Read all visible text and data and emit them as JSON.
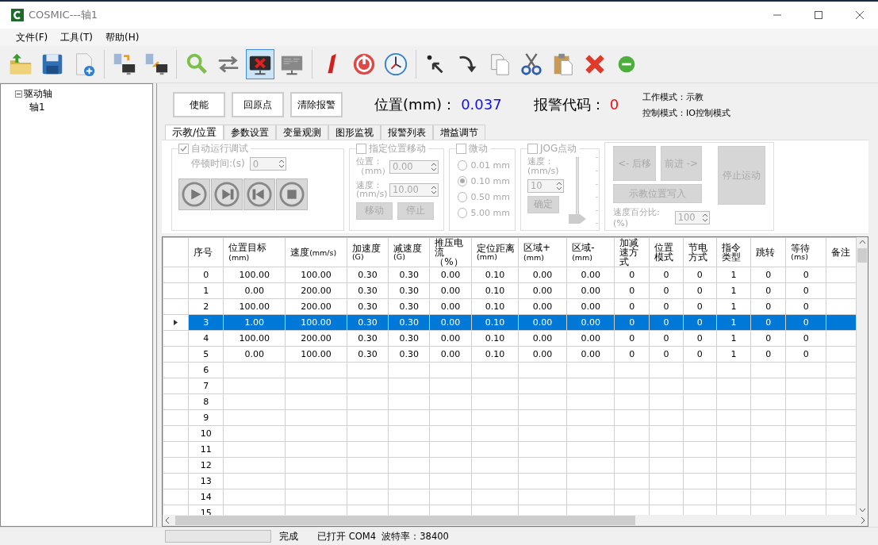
{
  "window": {
    "title": "COSMIC---轴1"
  },
  "menu": [
    "文件(F)",
    "工具(T)",
    "帮助(H)"
  ],
  "toolbar": [
    {
      "pressed": false
    },
    {
      "pressed": false
    },
    {
      "pressed": false
    },
    {
      "pressed": false
    },
    {
      "pressed": false
    },
    {
      "pressed": false
    },
    {
      "pressed": false
    },
    {
      "pressed": true
    },
    {
      "pressed": false
    },
    {
      "pressed": false
    },
    {
      "pressed": false
    },
    {
      "pressed": false
    },
    {
      "pressed": false
    },
    {
      "pressed": false
    },
    {
      "pressed": false
    },
    {
      "pressed": false
    },
    {
      "pressed": false
    },
    {
      "pressed": false
    },
    {
      "pressed": false
    }
  ],
  "tree": [
    {
      "label": "驱动轴",
      "expanded": true,
      "children": [
        {
          "label": "轴1"
        }
      ]
    }
  ],
  "actions": [
    "使能",
    "回原点",
    "清除报警"
  ],
  "position": {
    "label": "位置(mm)：",
    "value": "0.037"
  },
  "alarm": {
    "label": "报警代码：",
    "value": "0"
  },
  "modes": [
    "工作模式：示教",
    "控制模式：IO控制模式"
  ],
  "tabs": [
    {
      "label": "示教/位置",
      "selected": true
    },
    {
      "label": "参数设置",
      "selected": false
    },
    {
      "label": "变量观测",
      "selected": false
    },
    {
      "label": "图形监视",
      "selected": false
    },
    {
      "label": "报警列表",
      "selected": false
    },
    {
      "label": "增益调节",
      "selected": false
    }
  ],
  "auto_run": {
    "label": "自动运行调试",
    "checked": true,
    "disabled": true,
    "pause_label": "停顿时间:(s)",
    "pause_value": "0"
  },
  "target_move": {
    "label": "指定位置移动",
    "checked": false,
    "disabled": true,
    "position_label": "位置：",
    "position_unit": "（mm）",
    "position_value": "0.00",
    "speed_label": "速度：",
    "speed_unit": "(mm/s)",
    "speed_value": "10.00",
    "buttons": [
      "移动",
      "停止"
    ]
  },
  "jog_step": {
    "label": "微动",
    "checked": false,
    "disabled": true,
    "options": [
      {
        "label": "0.01 mm",
        "selected": false
      },
      {
        "label": "0.10 mm",
        "selected": true
      },
      {
        "label": "0.50 mm",
        "selected": false
      },
      {
        "label": "5.00 mm",
        "selected": false
      }
    ]
  },
  "jog": {
    "label": "JOG点动",
    "checked": false,
    "disabled": true,
    "speed_label": "速度：",
    "speed_unit": "(mm/s)",
    "speed_value": "10",
    "confirm": "确定",
    "level": 0
  },
  "teach": {
    "disabled": true,
    "back": "<- 后移",
    "forward": "前进 ->",
    "stop": "停止运动",
    "write": "示教位置写入",
    "percent_label": "速度百分比:(%)",
    "percent_value": "100"
  },
  "table": {
    "columns": [
      {
        "label": "序号",
        "kind": "plain"
      },
      {
        "label": "位置目标",
        "unit": "(mm)",
        "kind": "inline"
      },
      {
        "label": "速度",
        "unit": "(mm/s)",
        "kind": "inline"
      },
      {
        "label": "加速度",
        "unit": "(G)",
        "kind": "stacked"
      },
      {
        "label": "减速度",
        "unit": "(G)",
        "kind": "stacked"
      },
      {
        "label": "推压电流（%）",
        "kind": "plain"
      },
      {
        "label": "定位距离",
        "unit": "(mm)",
        "kind": "stacked"
      },
      {
        "label": "区域+",
        "unit": "(mm)",
        "kind": "inline"
      },
      {
        "label": "区域-",
        "unit": "(mm)",
        "kind": "inline"
      },
      {
        "label": "加减速方式",
        "kind": "plain"
      },
      {
        "label": "位置模式",
        "kind": "plain"
      },
      {
        "label": "节电方式",
        "kind": "plain"
      },
      {
        "label": "指令类型",
        "kind": "plain"
      },
      {
        "label": "跳转",
        "kind": "plain"
      },
      {
        "label": "等待",
        "unit": "(ms)",
        "kind": "stacked"
      },
      {
        "label": "备注",
        "kind": "plain"
      }
    ],
    "rows": [
      {
        "selected": false,
        "cells": [
          "0",
          "100.00",
          "100.00",
          "0.30",
          "0.30",
          "0.00",
          "0.10",
          "0.00",
          "0.00",
          "0",
          "0",
          "0",
          "1",
          "0",
          "0"
        ]
      },
      {
        "selected": false,
        "cells": [
          "1",
          "0.00",
          "200.00",
          "0.30",
          "0.30",
          "0.00",
          "0.10",
          "0.00",
          "0.00",
          "0",
          "0",
          "0",
          "1",
          "0",
          "0"
        ]
      },
      {
        "selected": false,
        "cells": [
          "2",
          "100.00",
          "200.00",
          "0.30",
          "0.30",
          "0.00",
          "0.10",
          "0.00",
          "0.00",
          "0",
          "0",
          "0",
          "1",
          "0",
          "0"
        ]
      },
      {
        "selected": true,
        "cells": [
          "3",
          "1.00",
          "100.00",
          "0.30",
          "0.30",
          "0.00",
          "0.10",
          "0.00",
          "0.00",
          "0",
          "0",
          "0",
          "1",
          "0",
          "0"
        ]
      },
      {
        "selected": false,
        "cells": [
          "4",
          "100.00",
          "200.00",
          "0.30",
          "0.30",
          "0.00",
          "0.10",
          "0.00",
          "0.00",
          "0",
          "0",
          "0",
          "1",
          "0",
          "0"
        ]
      },
      {
        "selected": false,
        "cells": [
          "5",
          "0.00",
          "100.00",
          "0.30",
          "0.30",
          "0.00",
          "0.10",
          "0.00",
          "0.00",
          "0",
          "0",
          "0",
          "1",
          "0",
          "0"
        ]
      },
      {
        "selected": false,
        "cells": [
          "6"
        ]
      },
      {
        "selected": false,
        "cells": [
          "7"
        ]
      },
      {
        "selected": false,
        "cells": [
          "8"
        ]
      },
      {
        "selected": false,
        "cells": [
          "9"
        ]
      },
      {
        "selected": false,
        "cells": [
          "10"
        ]
      },
      {
        "selected": false,
        "cells": [
          "11"
        ]
      },
      {
        "selected": false,
        "cells": [
          "12"
        ]
      },
      {
        "selected": false,
        "cells": [
          "13"
        ]
      },
      {
        "selected": false,
        "cells": [
          "14"
        ]
      },
      {
        "selected": false,
        "cells": [
          "15"
        ]
      }
    ]
  },
  "status_bar": {
    "state": "完成",
    "port": "已打开 COM4  波特率：38400"
  }
}
